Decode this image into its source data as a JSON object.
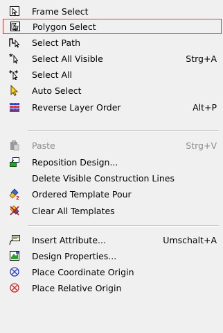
{
  "menu": {
    "items": [
      {
        "label": "Frame Select",
        "shortcut": "",
        "icon": "frame-select-icon"
      },
      {
        "label": "Polygon Select",
        "shortcut": "",
        "icon": "polygon-select-icon",
        "highlighted": true
      },
      {
        "label": "Select Path",
        "shortcut": "",
        "icon": "select-path-icon"
      },
      {
        "label": "Select All Visible",
        "shortcut": "Strg+A",
        "icon": "select-all-visible-icon"
      },
      {
        "label": "Select All",
        "shortcut": "",
        "icon": "select-all-icon"
      },
      {
        "label": "Auto Select",
        "shortcut": "",
        "icon": "auto-select-icon"
      },
      {
        "label": "Reverse Layer Order",
        "shortcut": "Alt+P",
        "icon": "layer-order-icon"
      },
      {
        "label": "Paste",
        "shortcut": "Strg+V",
        "icon": "paste-icon",
        "disabled": true
      },
      {
        "label": "Reposition Design...",
        "shortcut": "",
        "icon": "reposition-design-icon"
      },
      {
        "label": "Delete Visible Construction Lines",
        "shortcut": "",
        "icon": ""
      },
      {
        "label": "Ordered Template Pour",
        "shortcut": "",
        "icon": "template-pour-icon"
      },
      {
        "label": "Clear All Templates",
        "shortcut": "",
        "icon": "clear-templates-icon"
      },
      {
        "label": "Insert Attribute...",
        "shortcut": "Umschalt+A",
        "icon": "insert-attribute-icon"
      },
      {
        "label": "Design Properties...",
        "shortcut": "",
        "icon": "design-properties-icon"
      },
      {
        "label": "Place Coordinate Origin",
        "shortcut": "",
        "icon": "coordinate-origin-icon"
      },
      {
        "label": "Place Relative Origin",
        "shortcut": "",
        "icon": "relative-origin-icon"
      }
    ]
  },
  "colors": {
    "highlight_border": "#e03c3c",
    "origin_blue": "#2a3fc4",
    "origin_red": "#d0262a"
  }
}
